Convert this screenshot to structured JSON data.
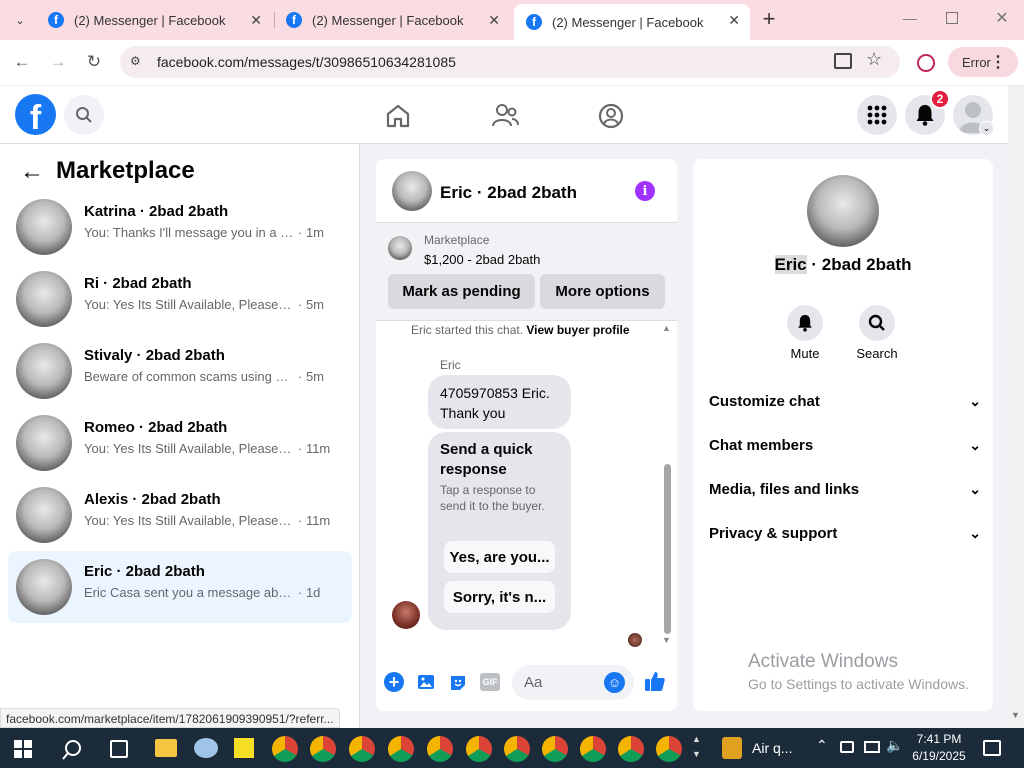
{
  "browser": {
    "tabs": [
      {
        "label": "(2) Messenger | Facebook"
      },
      {
        "label": "(2) Messenger | Facebook"
      },
      {
        "label": "(2) Messenger | Facebook"
      }
    ],
    "url": "facebook.com/messages/t/30986510634281085",
    "error_label": "Error",
    "status_url": "facebook.com/marketplace/item/1782061909390951/?referr..."
  },
  "header": {
    "notifications_count": "2"
  },
  "sidebar": {
    "title": "Marketplace",
    "conversations": [
      {
        "name": "Katrina · 2bad 2bath",
        "snippet": "You: Thanks I'll message you in a mo...",
        "time": "· 1m"
      },
      {
        "name": "Ri · 2bad 2bath",
        "snippet": "You: Yes Its Still Available, Please Sen...",
        "time": "· 5m"
      },
      {
        "name": "Stivaly · 2bad 2bath",
        "snippet": "Beware of common scams using pay...",
        "time": "· 5m"
      },
      {
        "name": "Romeo · 2bad 2bath",
        "snippet": "You: Yes Its Still Available, Please Se...",
        "time": "· 11m"
      },
      {
        "name": "Alexis · 2bad 2bath",
        "snippet": "You: Yes Its Still Available, Please Se...",
        "time": "· 11m"
      },
      {
        "name": "Eric · 2bad 2bath",
        "snippet": "Eric Casa sent you a message about y...",
        "time": "· 1d"
      }
    ]
  },
  "chat": {
    "title": "Eric · 2bad 2bath",
    "listing_source": "Marketplace",
    "listing_price": "$1,200 - 2bad 2bath",
    "mark_pending": "Mark as pending",
    "more_options": "More options",
    "started_text": "Eric started this chat.",
    "view_profile": "View buyer profile",
    "sender": "Eric",
    "message": "4705970853 Eric. Thank you",
    "quick_title": "Send a quick response",
    "quick_desc": "Tap a response to send it to the buyer.",
    "quick_replies": [
      "Yes, are you...",
      "Sorry, it's n..."
    ],
    "composer_placeholder": "Aa"
  },
  "info": {
    "name_first": "Eric",
    "name_rest": " · 2bad 2bath",
    "mute_label": "Mute",
    "search_label": "Search",
    "sections": [
      "Customize chat",
      "Chat members",
      "Media, files and links",
      "Privacy & support"
    ]
  },
  "watermark": {
    "title": "Activate Windows",
    "subtitle": "Go to Settings to activate Windows."
  },
  "taskbar": {
    "weather": "Air q...",
    "time": "7:41 PM",
    "date": "6/19/2025"
  },
  "colors": {
    "facebook_blue": "#1877f2",
    "selected_row": "#ebf5ff",
    "info_icon": "#a033ff",
    "badge": "#e41e3f"
  }
}
